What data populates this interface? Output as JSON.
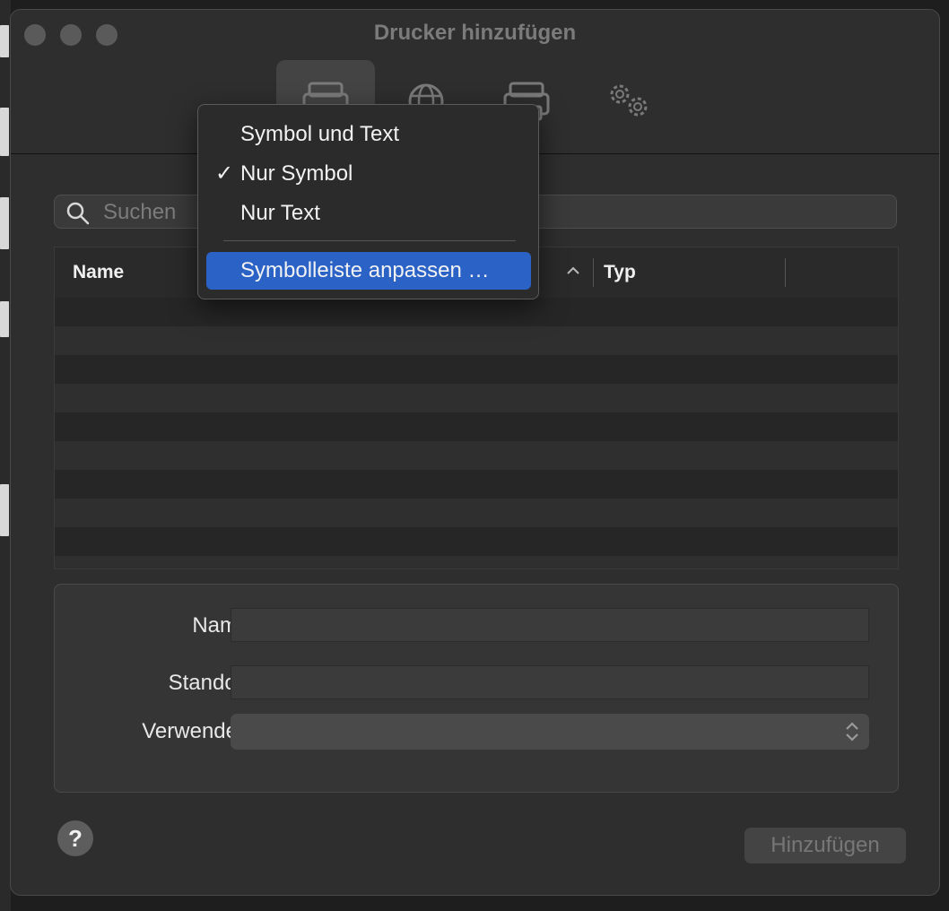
{
  "window": {
    "title": "Drucker hinzufügen"
  },
  "toolbar": {
    "buttons": [
      {
        "icon": "printer-icon",
        "active": true
      },
      {
        "icon": "globe-icon",
        "active": false
      },
      {
        "icon": "windows-printer-icon",
        "active": false
      },
      {
        "icon": "advanced-gears-icon",
        "active": false
      }
    ]
  },
  "context_menu": {
    "items": [
      {
        "label": "Symbol und Text",
        "checked": false
      },
      {
        "label": "Nur Symbol",
        "checked": true,
        "check_mark": "✓"
      },
      {
        "label": "Nur Text",
        "checked": false
      },
      {
        "label": "Symbolleiste anpassen …",
        "selected": true
      }
    ]
  },
  "search": {
    "placeholder": "Suchen",
    "value": ""
  },
  "table": {
    "columns": [
      "Name",
      "Typ"
    ],
    "rows": []
  },
  "form": {
    "name_label": "Name:",
    "location_label": "Standort:",
    "use_label": "Verwenden:",
    "name_value": "",
    "location_value": "",
    "use_value": ""
  },
  "help": {
    "label": "?"
  },
  "actions": {
    "add_label": "Hinzufügen"
  },
  "colors": {
    "accent": "#2a62c6",
    "window_bg": "#2e2e2e"
  }
}
